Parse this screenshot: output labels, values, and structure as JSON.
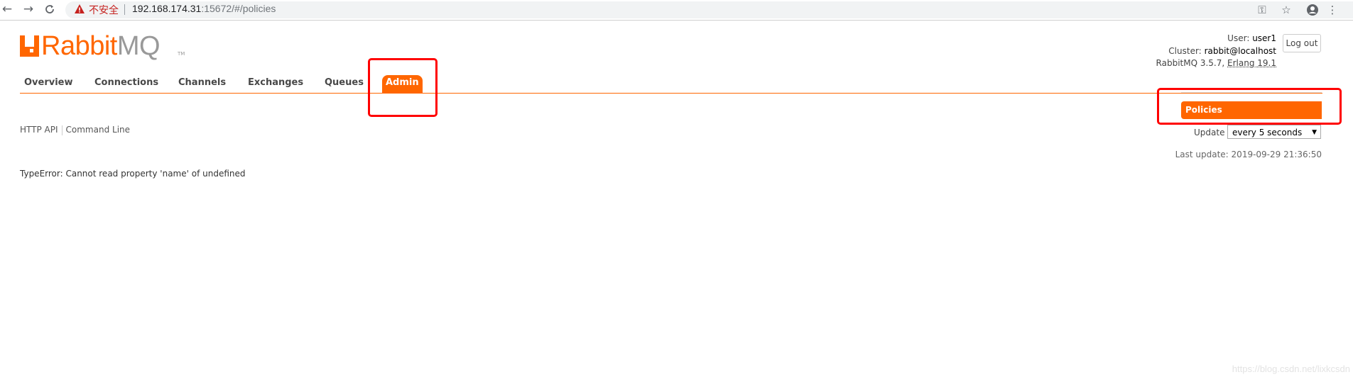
{
  "browser": {
    "back_icon": "←",
    "forward_icon": "→",
    "reload_icon": "C",
    "insecure_label": "不安全",
    "url_host": "192.168.174.31",
    "url_rest": ":15672/#/policies",
    "key_icon": "⚿",
    "star_icon": "☆",
    "profile_icon": "●",
    "menu_icon": "⋮"
  },
  "logo": {
    "rabbit": "Rabbit",
    "mq": "MQ",
    "tm": "TM"
  },
  "header": {
    "user_label": "User:",
    "user_value": "user1",
    "cluster_label": "Cluster:",
    "cluster_value": "rabbit@localhost",
    "version_text": "RabbitMQ 3.5.7,",
    "erlang_text": "Erlang 19.1",
    "logout_label": "Log out"
  },
  "tabs": [
    {
      "label": "Overview"
    },
    {
      "label": "Connections"
    },
    {
      "label": "Channels"
    },
    {
      "label": "Exchanges"
    },
    {
      "label": "Queues"
    },
    {
      "label": "Admin"
    }
  ],
  "subnav": {
    "active_label": "Policies"
  },
  "links": {
    "http_api": "HTTP API",
    "command_line": "Command Line"
  },
  "update": {
    "label": "Update",
    "selected": "every 5 seconds",
    "arrow": "▼"
  },
  "last_update": {
    "label": "Last update:",
    "value": "2019-09-29 21:36:50"
  },
  "error": "TypeError: Cannot read property 'name' of undefined",
  "watermark": "https://blog.csdn.net/lixkcsdn",
  "colors": {
    "accent": "#ff6600",
    "highlight": "#ff0000"
  }
}
